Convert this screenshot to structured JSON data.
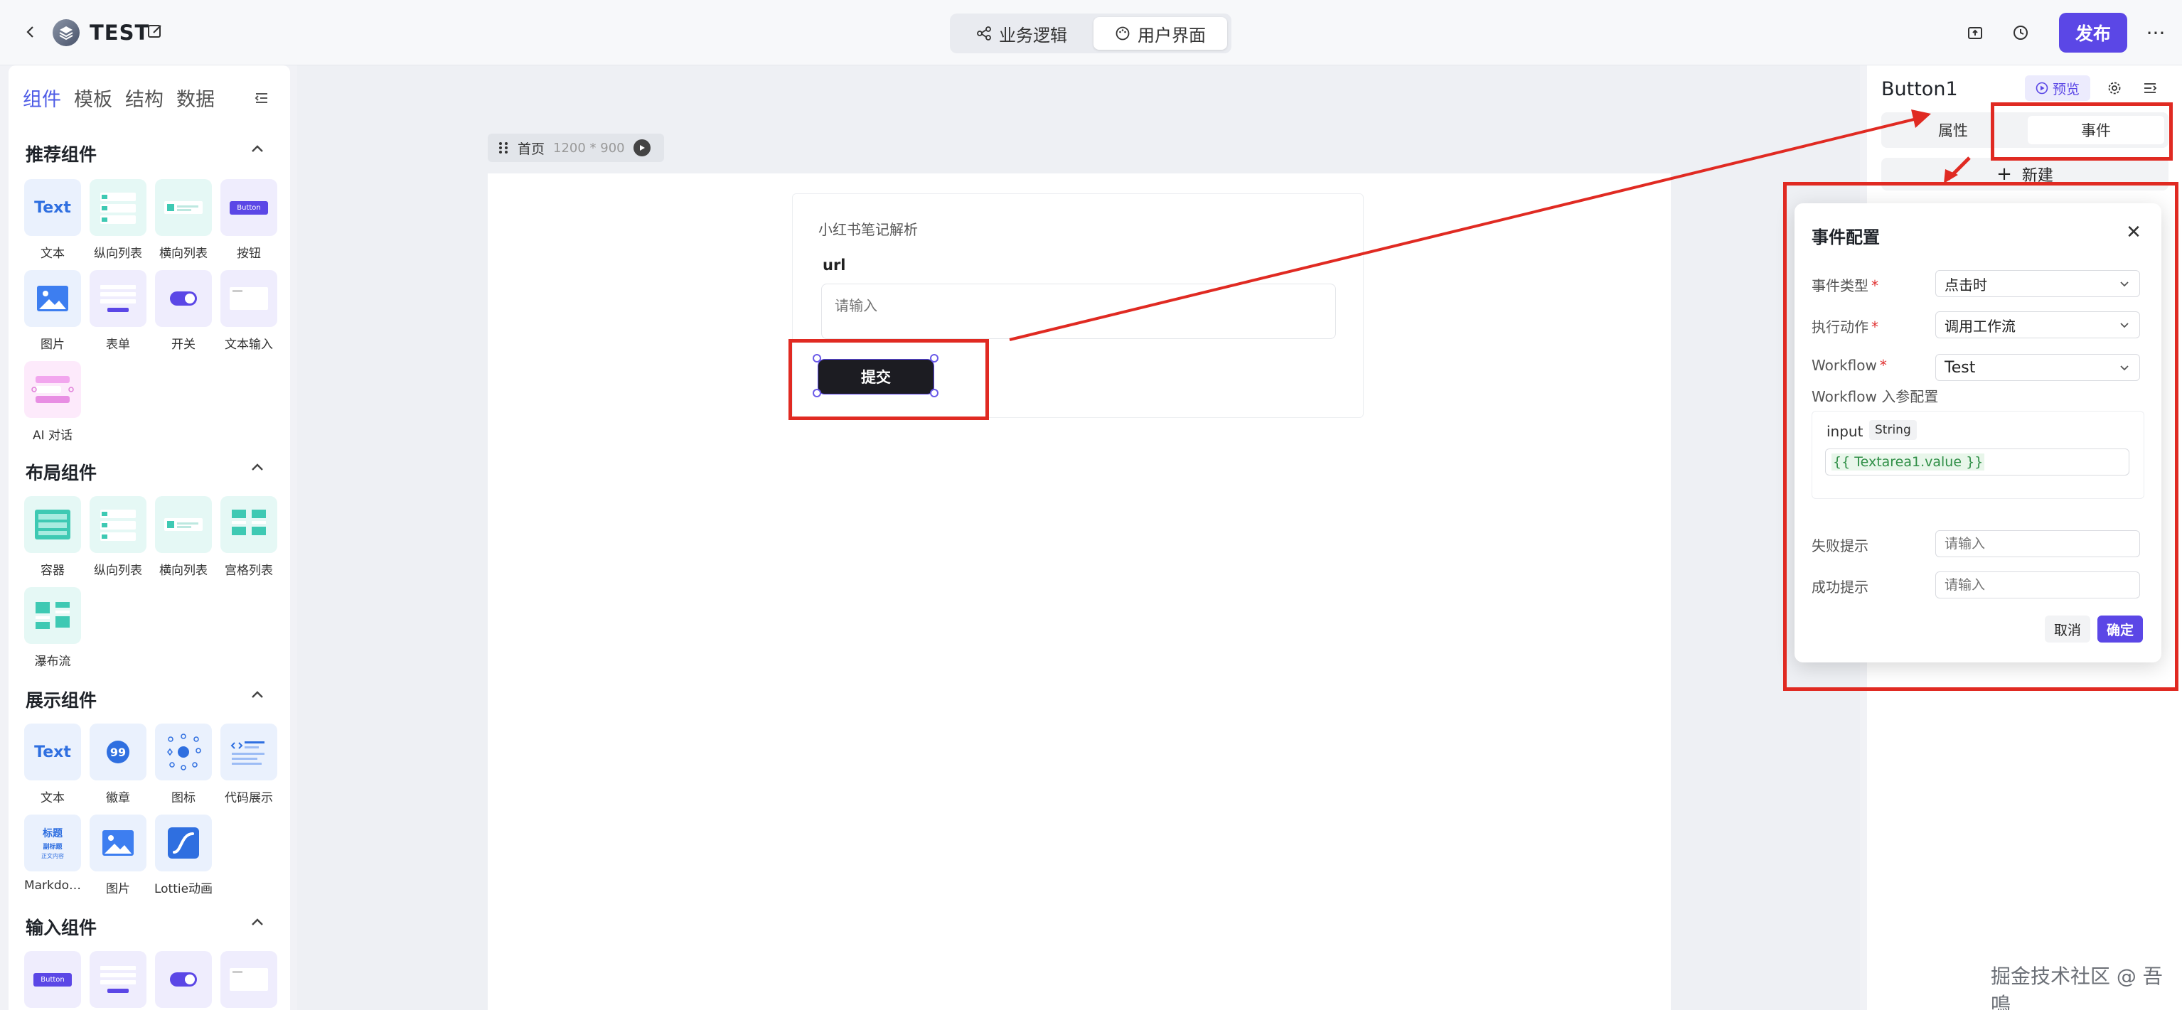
{
  "header": {
    "app_title": "TEST",
    "mode_tabs": [
      {
        "label": "业务逻辑"
      },
      {
        "label": "用户界面"
      }
    ],
    "publish_label": "发布",
    "more_label": "···"
  },
  "left_panel": {
    "tabs": [
      "组件",
      "模板",
      "结构",
      "数据"
    ],
    "sections": {
      "recommended": {
        "title": "推荐组件",
        "items": [
          "文本",
          "纵向列表",
          "横向列表",
          "按钮",
          "图片",
          "表单",
          "开关",
          "文本输入",
          "AI 对话"
        ]
      },
      "layout": {
        "title": "布局组件",
        "items": [
          "容器",
          "纵向列表",
          "横向列表",
          "宫格列表",
          "瀑布流"
        ]
      },
      "display": {
        "title": "展示组件",
        "items": [
          "文本",
          "徽章",
          "图标",
          "代码展示",
          "Markdo…",
          "图片",
          "Lottie动画"
        ]
      },
      "input": {
        "title": "输入组件"
      }
    },
    "thumb_text": {
      "text_glyph": "Text",
      "button_glyph": "Button",
      "badge_number": "99",
      "markdown_lines": [
        "标题",
        "副标题",
        "正文内容"
      ]
    }
  },
  "canvas": {
    "page_name": "首页",
    "page_size": "1200 * 900",
    "card_title": "小红书笔记解析",
    "url_label": "url",
    "url_placeholder": "请输入",
    "submit_label": "提交"
  },
  "right_panel": {
    "title": "Button1",
    "preview_label": "预览",
    "tabs": [
      "属性",
      "事件"
    ],
    "new_label": "新建"
  },
  "event_modal": {
    "title": "事件配置",
    "fields": {
      "event_type": {
        "label": "事件类型",
        "value": "点击时"
      },
      "action": {
        "label": "执行动作",
        "value": "调用工作流"
      },
      "workflow": {
        "label": "Workflow",
        "value": "Test"
      }
    },
    "params_label": "Workflow 入参配置",
    "param": {
      "name": "input",
      "type": "String",
      "value": "{{ Textarea1.value }}"
    },
    "fail_hint": {
      "label": "失败提示",
      "placeholder": "请输入"
    },
    "success_hint": {
      "label": "成功提示",
      "placeholder": "请输入"
    },
    "cancel_label": "取消",
    "ok_label": "确定"
  },
  "watermark": "掘金技术社区 @ 吾鳴",
  "colors": {
    "accent": "#5b47e6",
    "annotation_red": "#e02a22",
    "tab_active": "#4e5ce6"
  }
}
